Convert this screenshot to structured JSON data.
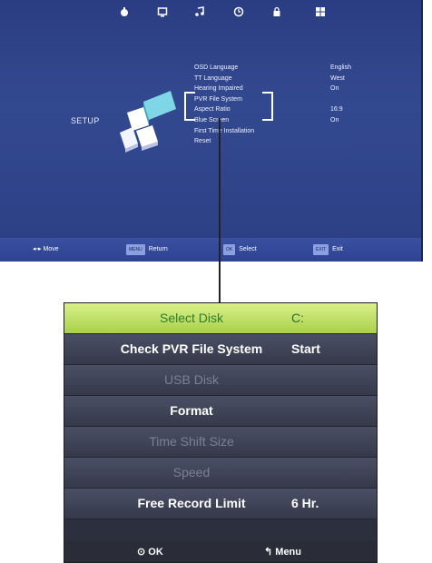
{
  "tv": {
    "top_icons": [
      "picture-icon",
      "channel-icon",
      "sound-icon",
      "time-icon",
      "lock-icon",
      "setup-icon"
    ],
    "section_label": "SETUP",
    "menu": [
      {
        "label": "OSD Language",
        "value": "English"
      },
      {
        "label": "TT Language",
        "value": "West"
      },
      {
        "label": "Hearing Impaired",
        "value": "On"
      },
      {
        "label": "PVR File System",
        "value": ""
      },
      {
        "label": "Aspect Ratio",
        "value": "16:9"
      },
      {
        "label": "Blue Screen",
        "value": "On"
      },
      {
        "label": "First Time Installation",
        "value": ""
      },
      {
        "label": "Reset",
        "value": ""
      }
    ],
    "footer": {
      "move": "Move",
      "return_key": "MENU",
      "return": "Return",
      "select_key": "OK",
      "select": "Select",
      "exit_key": "EXIT",
      "exit": "Exit"
    }
  },
  "panel": {
    "rows": [
      {
        "label": "Select Disk",
        "value": "C:",
        "state": "selected"
      },
      {
        "label": "Check PVR File System",
        "value": "Start",
        "state": "normal"
      },
      {
        "label": "USB Disk",
        "value": "",
        "state": "dim"
      },
      {
        "label": "Format",
        "value": "",
        "state": "normal"
      },
      {
        "label": "Time Shift Size",
        "value": "",
        "state": "dim"
      },
      {
        "label": "Speed",
        "value": "",
        "state": "dim"
      },
      {
        "label": "Free Record Limit",
        "value": "6 Hr.",
        "state": "normal"
      }
    ],
    "footer": {
      "ok": "OK",
      "menu": "Menu"
    }
  },
  "colors": {
    "tv_background": "#2c3f85",
    "selected_row": "#b8dc5a",
    "panel_row": "#404459"
  }
}
